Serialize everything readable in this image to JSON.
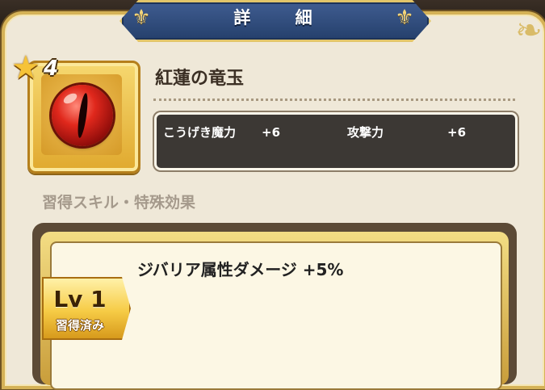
{
  "header": {
    "title": "詳 細"
  },
  "item": {
    "rarity": "4",
    "name": "紅蓮の竜玉",
    "stats": [
      {
        "label": "こうげき魔力",
        "value": "+6"
      },
      {
        "label": "攻撃力",
        "value": "+6"
      }
    ]
  },
  "skills": {
    "section_label": "習得スキル・特殊効果",
    "entries": [
      {
        "text": "ジバリア属性ダメージ +5%",
        "level": "Lv 1",
        "status": "習得済み"
      }
    ]
  },
  "icons": {
    "star": "star-icon",
    "orb": "dragon-orb-icon",
    "fleur": "fleur-de-lis-icon"
  },
  "colors": {
    "frame_gold": "#d5b257",
    "title_blue": "#2f4b7d",
    "stats_bg": "#3c3834",
    "orb_red": "#e0281c"
  }
}
